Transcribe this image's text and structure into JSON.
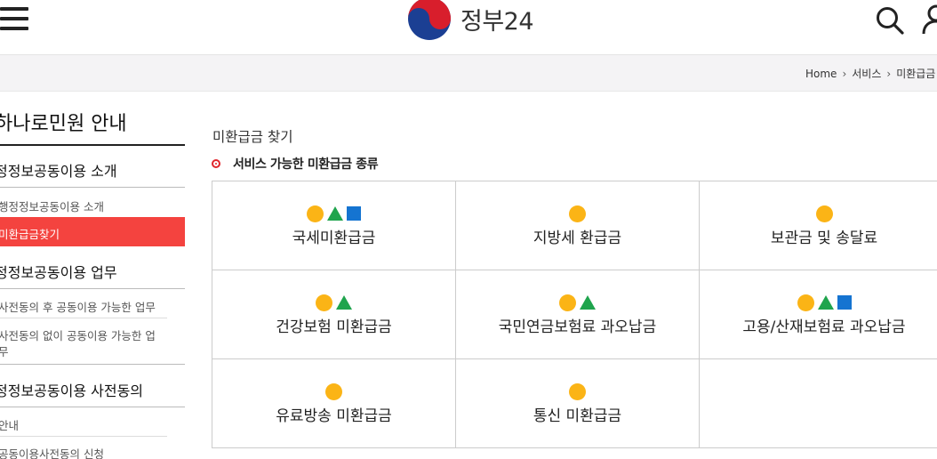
{
  "header": {
    "logo_text": "정부24",
    "menu_icon": "hamburger-menu-icon",
    "search_icon": "search-icon",
    "user_icon": "user-icon"
  },
  "breadcrumb": [
    "Home",
    "서비스",
    "미환급금"
  ],
  "sidebar": {
    "title": "하나로민원 안내",
    "sections": [
      {
        "heading": "정정보공동이용 소개",
        "items": [
          "행정정보공동이용 소개",
          "미환급금찾기"
        ],
        "active_item": 1
      },
      {
        "heading": "정정보공동이용 업무",
        "items": [
          "사전동의 후 공동이용 가능한 업무",
          "사전동의 없이 공동이용 가능한 업",
          "무"
        ]
      },
      {
        "heading": "정정보공동이용 사전동의",
        "items": [
          "안내",
          "공동이용사전동의 신청"
        ]
      }
    ]
  },
  "main": {
    "title": "미환급금 찾기",
    "section_label": "서비스 가능한 미환급금 종류",
    "colors": {
      "circle": "#fbb416",
      "triangle": "#1fa44d",
      "square": "#1574d1",
      "active": "#f4433f"
    },
    "cells": [
      {
        "label": "국세미환급금",
        "icons": [
          "circle",
          "triangle",
          "square"
        ]
      },
      {
        "label": "지방세 환급금",
        "icons": [
          "circle"
        ]
      },
      {
        "label": "보관금 및 송달료",
        "icons": [
          "circle"
        ]
      },
      {
        "label": "건강보험 미환급금",
        "icons": [
          "circle",
          "triangle"
        ]
      },
      {
        "label": "국민연금보험료 과오납금",
        "icons": [
          "circle",
          "triangle"
        ]
      },
      {
        "label": "고용/산재보험료 과오납금",
        "icons": [
          "circle",
          "triangle",
          "square"
        ]
      },
      {
        "label": "유료방송 미환급금",
        "icons": [
          "circle"
        ]
      },
      {
        "label": "통신 미환급금",
        "icons": [
          "circle"
        ]
      }
    ]
  }
}
